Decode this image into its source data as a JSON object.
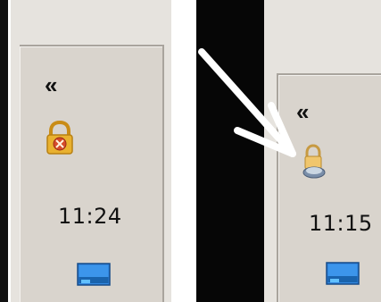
{
  "left": {
    "chevron_label": "«",
    "clock": "11:24",
    "tray_icon": "lock-warning-icon",
    "desktop_icon": "show-desktop-icon"
  },
  "right": {
    "chevron_label": "«",
    "clock": "11:15",
    "tray_icon": "lock-user-icon",
    "desktop_icon": "show-desktop-icon",
    "arrow": "white-arrow-icon"
  },
  "colors": {
    "tray_bg": "#d9d4cd",
    "panel_bg": "#e6e3de",
    "black": "#060606",
    "lock_gold": "#e9b12f",
    "warning_red": "#d64b2a",
    "monitor_blue": "#2a7bd6"
  }
}
